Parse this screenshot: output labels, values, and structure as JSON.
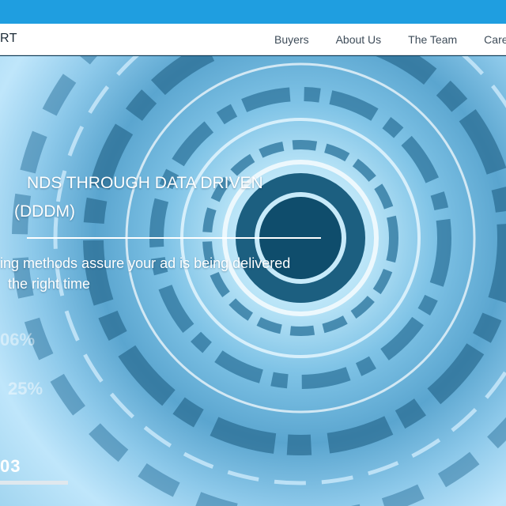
{
  "logo": {
    "text": "RT"
  },
  "nav": {
    "items": [
      {
        "label": "Buyers"
      },
      {
        "label": "About Us"
      },
      {
        "label": "The Team"
      },
      {
        "label": "Care"
      }
    ]
  },
  "hero": {
    "headline_line1": "NDS THROUGH DATA DRIVEN",
    "headline_line2": "(DDDM)",
    "subtext_line1": "ing methods assure your ad is being delivered",
    "subtext_line2": "the right time",
    "stat1": "06%",
    "stat2": "25%",
    "slide_number": "03"
  },
  "colors": {
    "topbar": "#1f9ee0",
    "navbar_bg": "#ffffff",
    "hero_text": "#ffffff"
  }
}
